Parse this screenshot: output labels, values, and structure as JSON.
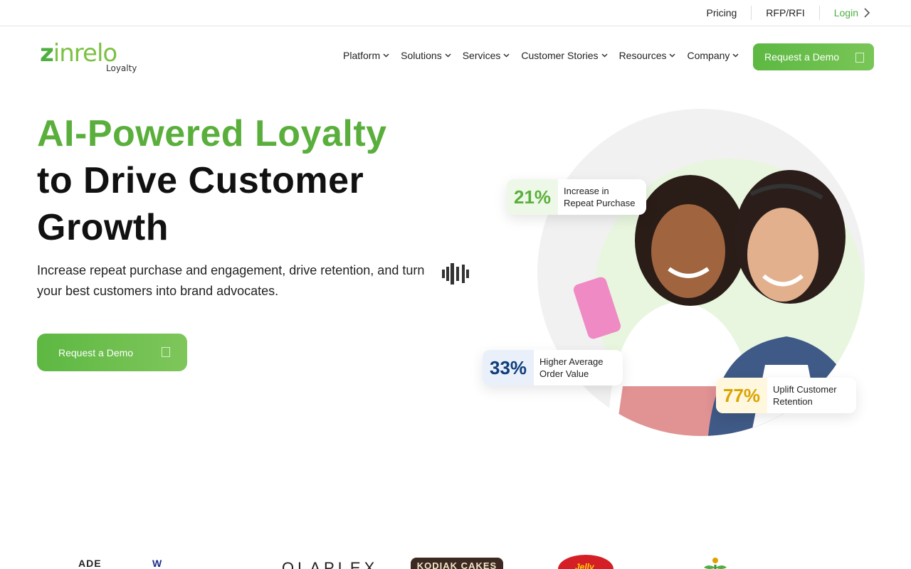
{
  "topbar": {
    "links": [
      "Pricing",
      "RFP/RFI"
    ],
    "login": "Login"
  },
  "logo": {
    "wordmark_first": "z",
    "wordmark_rest": "inrelo",
    "subtitle": "Loyalty"
  },
  "nav": {
    "items": [
      "Platform",
      "Solutions",
      "Services",
      "Customer Stories",
      "Resources",
      "Company"
    ],
    "cta": "Request a Demo"
  },
  "hero": {
    "title_green": "AI-Powered Loyalty",
    "title_dark_1": "to Drive Customer",
    "title_dark_2": "Growth",
    "subtitle": "Increase repeat purchase and engagement, drive retention, and turn your best customers into brand advocates.",
    "cta": "Request a Demo"
  },
  "stats": [
    {
      "value": "21%",
      "label_1": "Increase in",
      "label_2": "Repeat Purchase"
    },
    {
      "value": "33%",
      "label_1": "Higher Average",
      "label_2": "Order Value"
    },
    {
      "value": "77%",
      "label_1": "Uplift Customer",
      "label_2": "Retention"
    }
  ],
  "brands": [
    "ADE",
    "W",
    "OLAPLEX",
    "KODIAK CAKES",
    "Jelly"
  ],
  "colors": {
    "brand_green": "#5aaf3c",
    "light_green": "#7cc142",
    "navy": "#0e3d7a",
    "gold": "#d9a400"
  },
  "icons": [
    "chevron-right-icon",
    "chevron-down-icon",
    "audio-wave-icon"
  ]
}
